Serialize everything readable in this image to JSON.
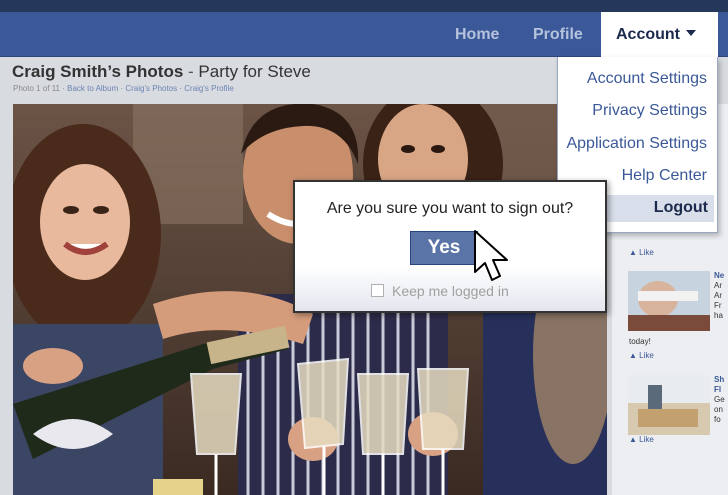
{
  "nav": {
    "home": "Home",
    "profile": "Profile",
    "account": "Account"
  },
  "page": {
    "owner": "Craig Smith’s Photos",
    "separator": "-",
    "album": "Party for Steve",
    "crumbs": {
      "photo_count": "Photo 1 of 11",
      "back": "Back to Album",
      "photos": "Craig's Photos",
      "profile": "Craig's Profile"
    }
  },
  "dropdown": {
    "items": [
      "Account Settings",
      "Privacy Settings",
      "Application Settings",
      "Help Center"
    ],
    "logout": "Logout"
  },
  "dialog": {
    "question": "Are you sure you want to sign out?",
    "yes": "Yes",
    "keep": "Keep me logged in"
  },
  "sidebar": {
    "like": "Like",
    "today": "today!",
    "snippets": [
      "Ne",
      "Ar",
      "Ar",
      "Fr",
      "ha"
    ],
    "snippets2": [
      "Sh",
      "Fl",
      "Ge",
      "on",
      "fo"
    ]
  },
  "colors": {
    "nav_bg": "#3b5998",
    "top_strip": "#25385c",
    "link": "#3b5998",
    "logout_bg": "#d8dfea"
  }
}
